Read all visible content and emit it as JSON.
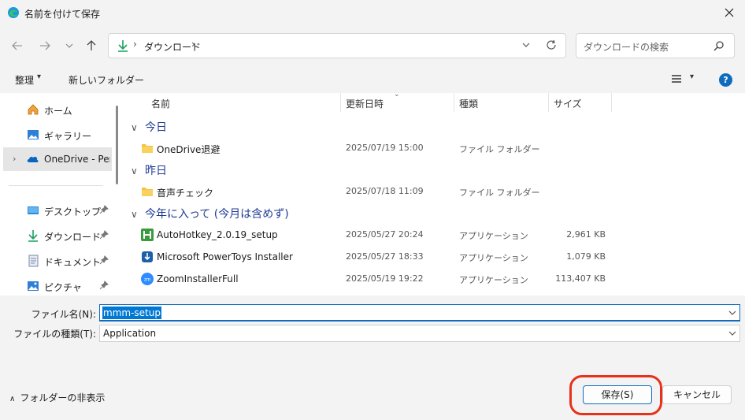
{
  "window": {
    "title": "名前を付けて保存"
  },
  "address": {
    "crumb": "ダウンロード",
    "separator": "›"
  },
  "search": {
    "placeholder": "ダウンロードの検索"
  },
  "commands": {
    "organize": "整理",
    "new_folder": "新しいフォルダー",
    "help": "?"
  },
  "nav": {
    "items": [
      {
        "label": "ホーム",
        "icon": "home-icon"
      },
      {
        "label": "ギャラリー",
        "icon": "gallery-icon"
      },
      {
        "label": "OneDrive - Personal",
        "icon": "onedrive-icon"
      },
      {
        "label": "デスクトップ",
        "icon": "desktop-icon"
      },
      {
        "label": "ダウンロード",
        "icon": "download-icon"
      },
      {
        "label": "ドキュメント",
        "icon": "documents-icon"
      },
      {
        "label": "ピクチャ",
        "icon": "pictures-icon"
      }
    ]
  },
  "columns": {
    "name": "名前",
    "modified": "更新日時",
    "type": "種類",
    "size": "サイズ"
  },
  "groups": [
    {
      "label": "今日"
    },
    {
      "label": "昨日"
    },
    {
      "label": "今年に入って (今月は含めず)"
    }
  ],
  "files": [
    {
      "name": "OneDrive退避",
      "modified": "2025/07/19 15:00",
      "type": "ファイル フォルダー",
      "size": ""
    },
    {
      "name": "音声チェック",
      "modified": "2025/07/18 11:09",
      "type": "ファイル フォルダー",
      "size": ""
    },
    {
      "name": "AutoHotkey_2.0.19_setup",
      "modified": "2025/05/27 20:24",
      "type": "アプリケーション",
      "size": "2,961 KB"
    },
    {
      "name": "Microsoft PowerToys Installer",
      "modified": "2025/05/27 18:33",
      "type": "アプリケーション",
      "size": "1,079 KB"
    },
    {
      "name": "ZoomInstallerFull",
      "modified": "2025/05/19 19:22",
      "type": "アプリケーション",
      "size": "113,407 KB"
    }
  ],
  "form": {
    "filename_label": "ファイル名(N):",
    "filename_value": "mmm-setup",
    "filetype_label": "ファイルの種類(T):",
    "filetype_value": "Application"
  },
  "footer": {
    "hide_folders": "フォルダーの非表示",
    "save": "保存(S)",
    "cancel": "キャンセル"
  },
  "colors": {
    "accent": "#0f6cbd",
    "highlight": "#e8311a",
    "folder": "#f5c242"
  }
}
